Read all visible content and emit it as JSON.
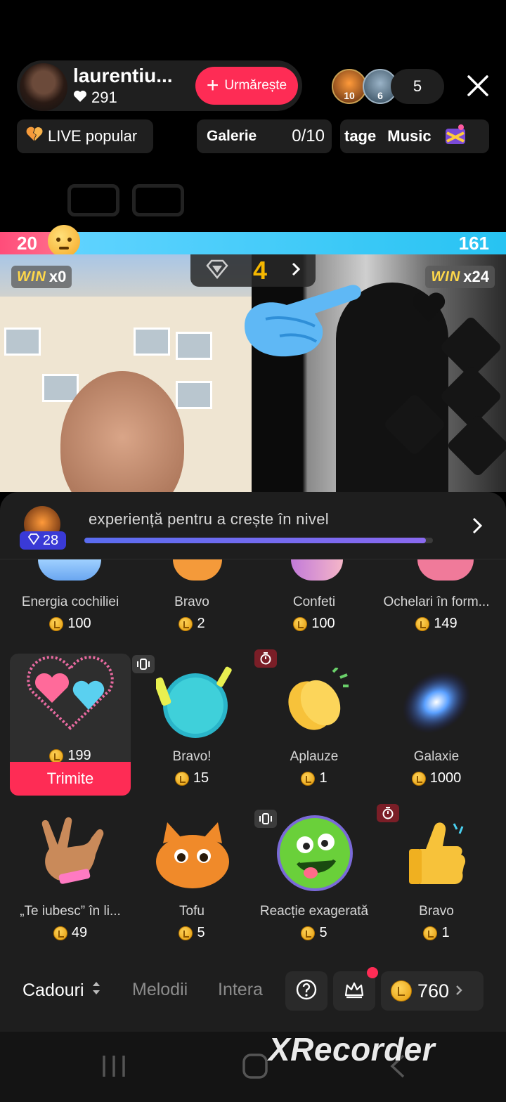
{
  "host": {
    "name": "laurentiu...",
    "likes": "291",
    "follow_label": "Urmărește"
  },
  "viewers": {
    "avatar_levels": [
      "10",
      "6"
    ],
    "count": "5"
  },
  "chips": {
    "popular": "LIVE popular",
    "gallery_label": "Galerie",
    "gallery_count": "0/10",
    "stage_text": "​tage",
    "music_label": "Music"
  },
  "battle": {
    "left_score": "20",
    "right_score": "161",
    "left_win_label": "WIN",
    "left_win_count": "x0",
    "right_win_label": "WIN",
    "right_win_count": "x24",
    "center_count": "4"
  },
  "level": {
    "badge": "28",
    "text": "experiență pentru a crește în nivel",
    "progress": 0.98
  },
  "gifts": [
    {
      "name": "Energia cochiliei",
      "price": "100"
    },
    {
      "name": "Bravo",
      "price": "2"
    },
    {
      "name": "Confeti",
      "price": "100"
    },
    {
      "name": "Ochelari în form...",
      "price": "149"
    },
    {
      "name": "",
      "price": "199",
      "selected": true
    },
    {
      "name": "Bravo!",
      "price": "15"
    },
    {
      "name": "Aplauze",
      "price": "1"
    },
    {
      "name": "Galaxie",
      "price": "1000"
    },
    {
      "name": "„Te iubesc” în li...",
      "price": "49"
    },
    {
      "name": "Tofu",
      "price": "5"
    },
    {
      "name": "Reacție exagerată",
      "price": "5"
    },
    {
      "name": "Bravo",
      "price": "1"
    }
  ],
  "send_label": "Trimite",
  "tabs": {
    "cadouri": "Cadouri",
    "melodii": "Melodii",
    "intera": "Intera"
  },
  "balance": "760",
  "watermark": "XRecorder",
  "colors": {
    "accent": "#fe2c55",
    "gold": "#f5b700",
    "panel": "#1e1e1e"
  }
}
